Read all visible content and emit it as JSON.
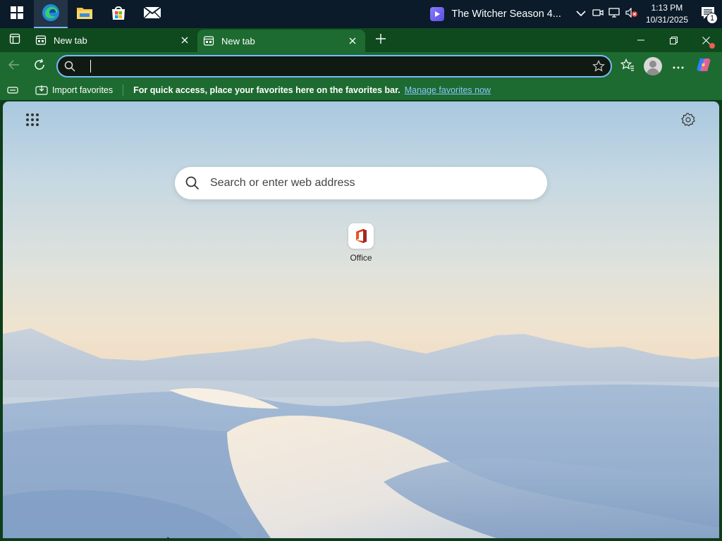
{
  "taskbar": {
    "apps": [
      {
        "name": "start-icon"
      },
      {
        "name": "edge-icon",
        "active": true
      },
      {
        "name": "file-explorer-icon"
      },
      {
        "name": "microsoft-store-icon"
      },
      {
        "name": "mail-icon"
      }
    ],
    "media_title": "The Witcher Season 4...",
    "clock_time": "1:13 PM",
    "clock_date": "10/31/2025",
    "notification_count": "1"
  },
  "tabs": [
    {
      "title": "New tab",
      "active": false
    },
    {
      "title": "New tab",
      "active": true
    }
  ],
  "toolbar": {
    "address_value": "",
    "address_placeholder": ""
  },
  "favorites_bar": {
    "import_label": "Import favorites",
    "hint": "For quick access, place your favorites here on the favorites bar.",
    "manage_link": "Manage favorites now"
  },
  "new_tab_page": {
    "search_placeholder": "Search or enter web address",
    "quick_links": [
      {
        "label": "Office"
      }
    ]
  },
  "colors": {
    "browser_frame": "#1d6b30",
    "tabstrip": "#0f4a1e",
    "taskbar": "#0b1b2a",
    "address_focus": "#78b9ff",
    "link": "#8ec5ff"
  }
}
